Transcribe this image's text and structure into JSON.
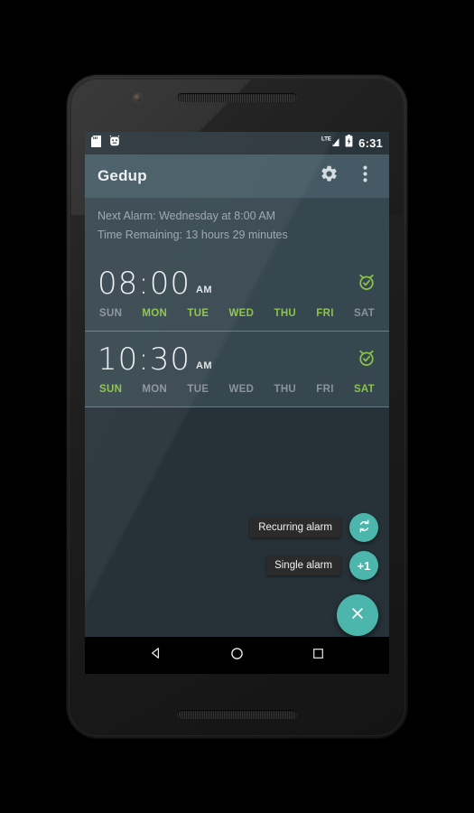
{
  "status_bar": {
    "left_icons": [
      "sd-card-icon",
      "android-app-icon"
    ],
    "network_label": "LTE",
    "right_icons": [
      "lte-signal-icon",
      "battery-charging-icon"
    ],
    "time": "6:31"
  },
  "app_bar": {
    "title": "Gedup",
    "actions": [
      "settings-gear-icon",
      "overflow-menu-icon"
    ]
  },
  "info_banner": {
    "next_alarm": "Next Alarm: Wednesday at 8:00 AM",
    "time_remaining": "Time Remaining: 13 hours 29 minutes"
  },
  "colors": {
    "accent_teal": "#4DB6AC",
    "active_day_green": "#8BC34A",
    "inactive_day_gray": "#8A9499",
    "app_bar": "#455A64",
    "card": "#37474F",
    "background": "#263238",
    "status_bar": "#2A343B"
  },
  "alarms": [
    {
      "time": "08:00",
      "meridiem": "AM",
      "enabled": true,
      "toggle_icon": "alarm-check-icon",
      "days": [
        {
          "label": "SUN",
          "active": false
        },
        {
          "label": "MON",
          "active": true
        },
        {
          "label": "TUE",
          "active": true
        },
        {
          "label": "WED",
          "active": true
        },
        {
          "label": "THU",
          "active": true
        },
        {
          "label": "FRI",
          "active": true
        },
        {
          "label": "SAT",
          "active": false
        }
      ]
    },
    {
      "time": "10:30",
      "meridiem": "AM",
      "enabled": true,
      "toggle_icon": "alarm-check-icon",
      "days": [
        {
          "label": "SUN",
          "active": true
        },
        {
          "label": "MON",
          "active": false
        },
        {
          "label": "TUE",
          "active": false
        },
        {
          "label": "WED",
          "active": false
        },
        {
          "label": "THU",
          "active": false
        },
        {
          "label": "FRI",
          "active": false
        },
        {
          "label": "SAT",
          "active": true
        }
      ]
    }
  ],
  "fab_menu": {
    "expanded": true,
    "items": [
      {
        "label": "Recurring alarm",
        "icon": "repeat-icon",
        "icon_text": ""
      },
      {
        "label": "Single alarm",
        "icon": "plus-one-icon",
        "icon_text": "+1"
      }
    ],
    "main_icon": "close-icon"
  },
  "nav_bar": {
    "buttons": [
      "back-triangle-icon",
      "home-circle-icon",
      "recents-square-icon"
    ]
  }
}
